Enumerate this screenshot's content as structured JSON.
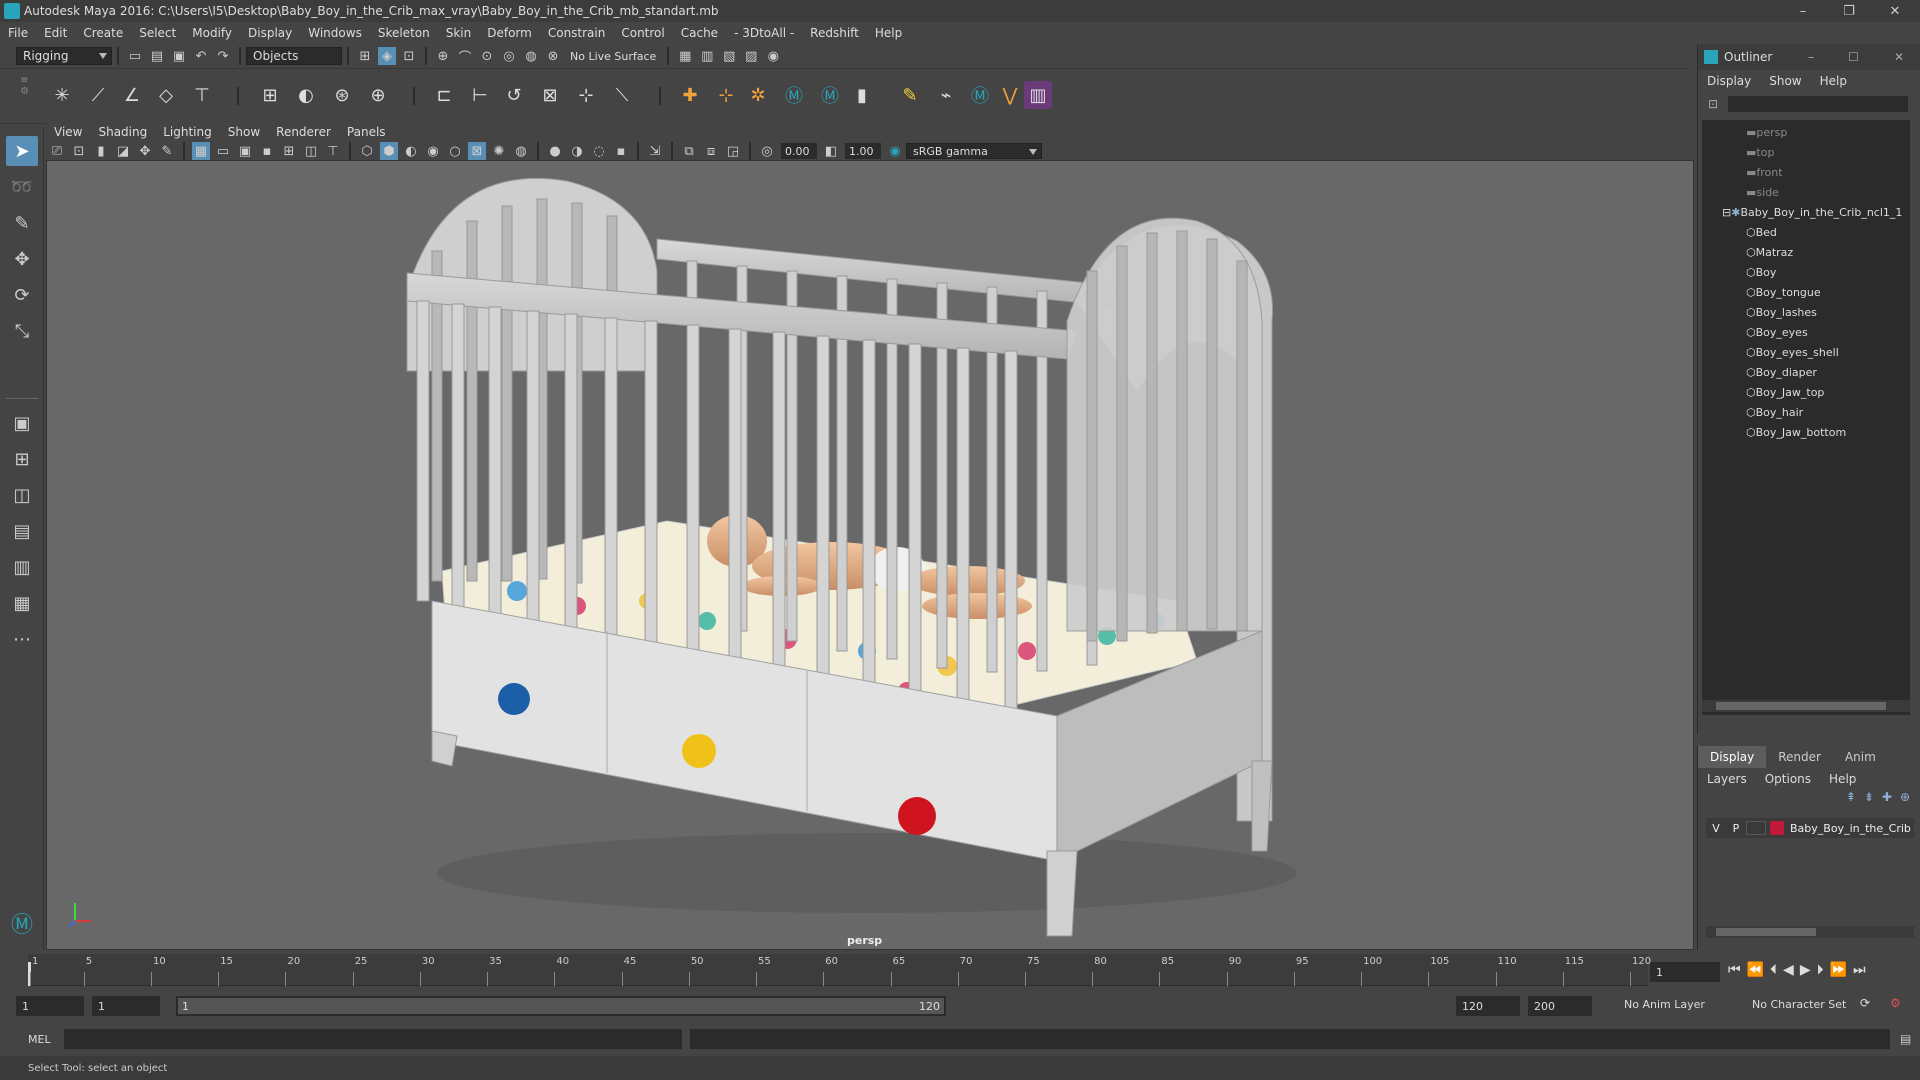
{
  "window": {
    "title": "Autodesk Maya 2016: C:\\Users\\I5\\Desktop\\Baby_Boy_in_the_Crib_max_vray\\Baby_Boy_in_the_Crib_mb_standart.mb",
    "minimize": "–",
    "maximize": "❐",
    "close": "✕"
  },
  "menu": [
    "File",
    "Edit",
    "Create",
    "Select",
    "Modify",
    "Display",
    "Windows",
    "Skeleton",
    "Skin",
    "Deform",
    "Constrain",
    "Control",
    "Cache",
    "- 3DtoAll -",
    "Redshift",
    "Help"
  ],
  "statusline": {
    "mode": "Rigging",
    "objects": "Objects",
    "live_surface": "No Live Surface"
  },
  "panel": {
    "menu": [
      "View",
      "Shading",
      "Lighting",
      "Show",
      "Renderer",
      "Panels"
    ],
    "exposure": "0.00",
    "gamma": "1.00",
    "color_space": "sRGB gamma",
    "camera_label": "persp"
  },
  "outliner": {
    "title": "Outliner",
    "menu": [
      "Display",
      "Show",
      "Help"
    ],
    "items": [
      {
        "label": "persp",
        "dim": true
      },
      {
        "label": "top",
        "dim": true
      },
      {
        "label": "front",
        "dim": true
      },
      {
        "label": "side",
        "dim": true
      },
      {
        "label": "Baby_Boy_in_the_Crib_ncl1_1",
        "dim": false
      },
      {
        "label": "Bed",
        "dim": false
      },
      {
        "label": "Matraz",
        "dim": false
      },
      {
        "label": "Boy",
        "dim": false
      },
      {
        "label": "Boy_tongue",
        "dim": false
      },
      {
        "label": "Boy_lashes",
        "dim": false
      },
      {
        "label": "Boy_eyes",
        "dim": false
      },
      {
        "label": "Boy_eyes_shell",
        "dim": false
      },
      {
        "label": "Boy_diaper",
        "dim": false
      },
      {
        "label": "Boy_Jaw_top",
        "dim": false
      },
      {
        "label": "Boy_hair",
        "dim": false
      },
      {
        "label": "Boy_Jaw_bottom",
        "dim": false
      }
    ]
  },
  "layers": {
    "tabs": [
      "Display",
      "Render",
      "Anim"
    ],
    "active_tab": "Display",
    "menu": [
      "Layers",
      "Options",
      "Help"
    ],
    "row": {
      "v": "V",
      "p": "P",
      "name": "Baby_Boy_in_the_Crib",
      "color": "#c0193a"
    }
  },
  "timeline": {
    "ticks": [
      "1",
      "5",
      "10",
      "15",
      "20",
      "25",
      "30",
      "35",
      "40",
      "45",
      "50",
      "55",
      "60",
      "65",
      "70",
      "75",
      "80",
      "85",
      "90",
      "95",
      "100",
      "105",
      "110",
      "115",
      "120"
    ],
    "current_frame": "1"
  },
  "range": {
    "start": "1",
    "current": "1",
    "slider_start": "1",
    "slider_end": "120",
    "end": "120",
    "max": "200",
    "anim_layer": "No Anim Layer",
    "character_set": "No Character Set"
  },
  "command": {
    "label": "MEL"
  },
  "help": {
    "text": "Select Tool: select an object"
  },
  "colors": {
    "accent": "#5a8fb5",
    "bg": "#444444",
    "viewport": "#686868"
  }
}
